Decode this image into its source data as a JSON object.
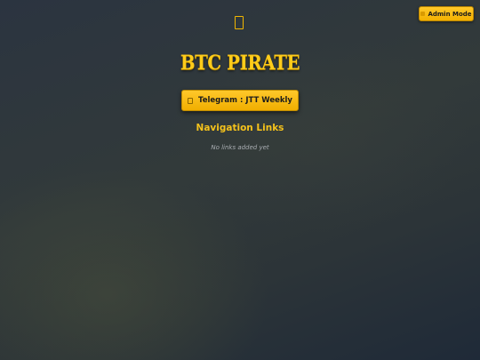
{
  "admin": {
    "label": "Admin Mode",
    "icon": "admin-icon"
  },
  "logo": {
    "icon": "logo-icon"
  },
  "site": {
    "title": "BTC PIRATE"
  },
  "telegram": {
    "label": "Telegram : JTT Weekly",
    "icon": "telegram-icon"
  },
  "navigation": {
    "heading": "Navigation Links",
    "empty_text": "No links added yet",
    "links": []
  },
  "colors": {
    "accent": "#ffc107",
    "heading": "#f5c21b",
    "background": "#2a323c",
    "muted_text": "#a9adb2"
  }
}
